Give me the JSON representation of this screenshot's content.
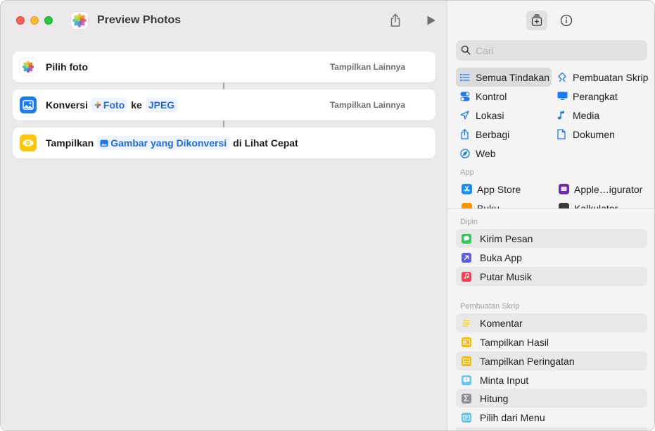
{
  "window": {
    "title": "Preview Photos"
  },
  "toolbar": {
    "share_icon": "share-icon",
    "run_icon": "play-icon"
  },
  "actions": [
    {
      "label": "Pilih foto",
      "more": "Tampilkan Lainnya",
      "icon": "photos-icon"
    },
    {
      "prefix": "Konversi",
      "token1": "Foto",
      "middle": "ke",
      "token2": "JPEG",
      "more": "Tampilkan Lainnya",
      "icon": "image-convert-icon"
    },
    {
      "prefix": "Tampilkan",
      "token1": "Gambar yang Dikonversi",
      "suffix": "di Lihat Cepat",
      "icon": "eye-icon"
    }
  ],
  "library": {
    "search": {
      "placeholder": "Cari",
      "value": ""
    },
    "categories": [
      {
        "label": "Semua Tindakan",
        "icon": "list-icon",
        "selected": true
      },
      {
        "label": "Pembuatan Skrip",
        "icon": "scripting-icon"
      },
      {
        "label": "Kontrol",
        "icon": "toggle-icon"
      },
      {
        "label": "Perangkat",
        "icon": "display-icon"
      },
      {
        "label": "Lokasi",
        "icon": "location-arrow-icon"
      },
      {
        "label": "Media",
        "icon": "music-note-icon"
      },
      {
        "label": "Berbagi",
        "icon": "share-icon"
      },
      {
        "label": "Dokumen",
        "icon": "document-icon"
      },
      {
        "label": "Web",
        "icon": "compass-icon"
      }
    ],
    "app_section_label": "App",
    "apps": [
      {
        "label": "App Store",
        "icon": "app-store-icon"
      },
      {
        "label": "Apple…igurator",
        "icon": "apple-configurator-icon"
      },
      {
        "label": "Buku",
        "icon": "books-icon"
      },
      {
        "label": "Kalkulator",
        "icon": "calculator-icon"
      }
    ],
    "pinned_label": "Dipin",
    "pinned": [
      {
        "label": "Kirim Pesan",
        "color": "#34c759"
      },
      {
        "label": "Buka App",
        "color": "#5e5ce6"
      },
      {
        "label": "Putar Musik",
        "color": "#fa3c4c"
      }
    ],
    "scripting_label": "Pembuatan Skrip",
    "scripting": [
      {
        "label": "Komentar",
        "color": "#ffd60a"
      },
      {
        "label": "Tampilkan Hasil",
        "color": "#ffb800"
      },
      {
        "label": "Tampilkan Peringatan",
        "color": "#ffb800"
      },
      {
        "label": "Minta Input",
        "color": "#5ac8fa"
      },
      {
        "label": "Hitung",
        "color": "#8e8e93"
      },
      {
        "label": "Pilih dari Menu",
        "color": "#5ac8fa"
      }
    ]
  }
}
